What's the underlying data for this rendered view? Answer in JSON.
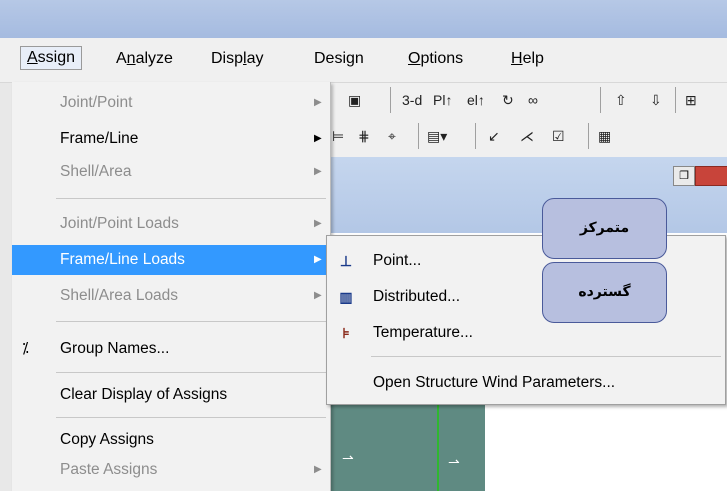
{
  "menubar": {
    "items": [
      "Assign",
      "Analyze",
      "Display",
      "Design",
      "Options",
      "Help"
    ],
    "active": "Assign"
  },
  "toolbar": {
    "row1": [
      "3-d",
      "Pl↑",
      "el↑"
    ],
    "label_3d": "3-d"
  },
  "assign_menu": {
    "items": [
      {
        "label": "Joint/Point",
        "state": "disabled",
        "submenu": true
      },
      {
        "label": "Frame/Line",
        "state": "enabled",
        "submenu": true
      },
      {
        "label": "Shell/Area",
        "state": "disabled",
        "submenu": true
      },
      {
        "label": "Joint/Point Loads",
        "state": "disabled",
        "submenu": true
      },
      {
        "label": "Frame/Line Loads",
        "state": "highlighted",
        "submenu": true
      },
      {
        "label": "Shell/Area Loads",
        "state": "disabled",
        "submenu": true
      },
      {
        "label": "Group Names...",
        "state": "enabled",
        "submenu": false,
        "icon": "group-names-icon"
      },
      {
        "label": "Clear Display of Assigns",
        "state": "enabled",
        "submenu": false
      },
      {
        "label": "Copy Assigns",
        "state": "enabled",
        "submenu": false
      },
      {
        "label": "Paste Assigns",
        "state": "disabled",
        "submenu": true
      }
    ]
  },
  "frame_line_loads_submenu": {
    "items": [
      {
        "label": "Point...",
        "icon": "point-load-icon"
      },
      {
        "label": "Distributed...",
        "icon": "distributed-load-icon"
      },
      {
        "label": "Temperature...",
        "icon": "temperature-load-icon"
      },
      {
        "label": "Open Structure Wind Parameters...",
        "icon": ""
      }
    ]
  },
  "annotations": {
    "note1": "متمرکز",
    "note2": "گسترده"
  },
  "colors": {
    "highlight": "#3399ff",
    "note_fill": "#b7bfdf",
    "model_bg": "#5f8a82"
  }
}
